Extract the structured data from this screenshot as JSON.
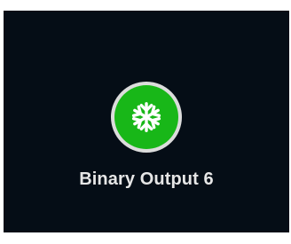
{
  "device": {
    "label": "Binary Output 6",
    "icon": "snowflake-icon",
    "state": "on"
  },
  "colors": {
    "tile_background": "#050d16",
    "status_ring": "#dcdcdc",
    "status_fill": "#18b718",
    "icon": "#ffffff",
    "label_text": "#e6e6e6"
  }
}
